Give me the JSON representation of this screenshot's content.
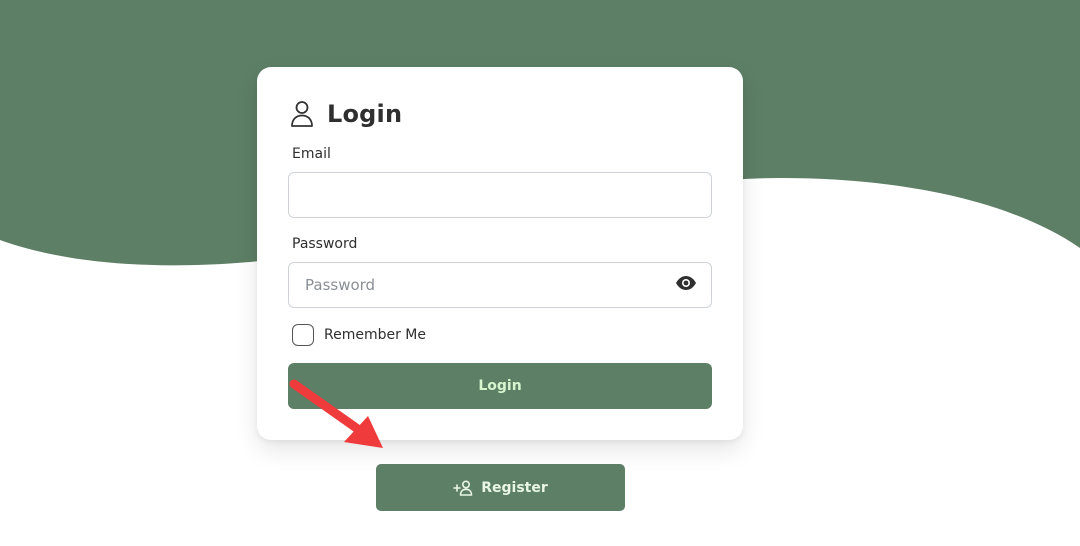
{
  "colors": {
    "brand_green": "#5d7f65",
    "button_text": "#d6f5cf",
    "annotation_arrow": "#ef3b3b"
  },
  "login_card": {
    "title": "Login",
    "title_icon": "user-icon",
    "email": {
      "label": "Email",
      "value": "",
      "placeholder": ""
    },
    "password": {
      "label": "Password",
      "value": "",
      "placeholder": "Password",
      "toggle_icon": "eye-icon"
    },
    "remember_me": {
      "label": "Remember Me",
      "checked": false
    },
    "login_button": "Login"
  },
  "register_button": {
    "label": "Register",
    "icon": "user-plus-icon"
  }
}
